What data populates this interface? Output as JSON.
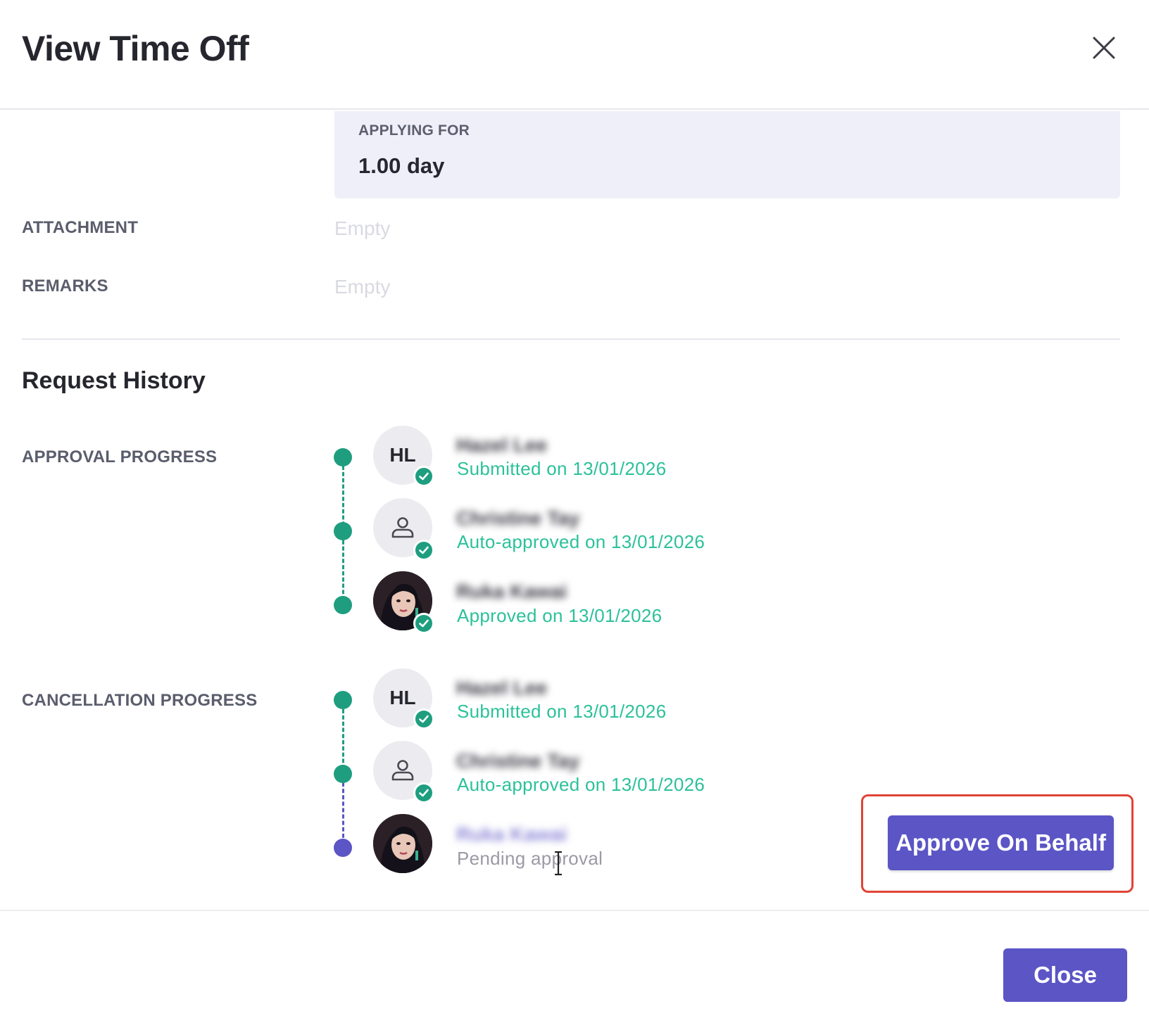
{
  "modal": {
    "title": "View Time Off"
  },
  "applying_for": {
    "label": "APPLYING FOR",
    "value": "1.00 day"
  },
  "fields": {
    "attachment_label": "ATTACHMENT",
    "attachment_value": "Empty",
    "remarks_label": "REMARKS",
    "remarks_value": "Empty"
  },
  "history": {
    "title": "Request History",
    "approval": {
      "label": "APPROVAL PROGRESS",
      "steps": [
        {
          "avatar": "HL",
          "name": "Hazel Lee",
          "status": "Submitted on 13/01/2026"
        },
        {
          "avatar": "person-icon",
          "name": "Christine Tay",
          "status": "Auto-approved on 13/01/2026"
        },
        {
          "avatar": "photo",
          "name": "Ruka Kawai",
          "status": "Approved on 13/01/2026"
        }
      ]
    },
    "cancellation": {
      "label": "CANCELLATION PROGRESS",
      "steps": [
        {
          "avatar": "HL",
          "name": "Hazel Lee",
          "status": "Submitted on 13/01/2026"
        },
        {
          "avatar": "person-icon",
          "name": "Christine Tay",
          "status": "Auto-approved on 13/01/2026"
        },
        {
          "avatar": "photo",
          "name": "Ruka Kawai",
          "status": "Pending approval"
        }
      ]
    }
  },
  "actions": {
    "approve_on_behalf": "Approve On Behalf",
    "close": "Close"
  },
  "colors": {
    "primary": "#5b55c6",
    "success": "#1e9e7f",
    "highlight": "#e04436"
  }
}
